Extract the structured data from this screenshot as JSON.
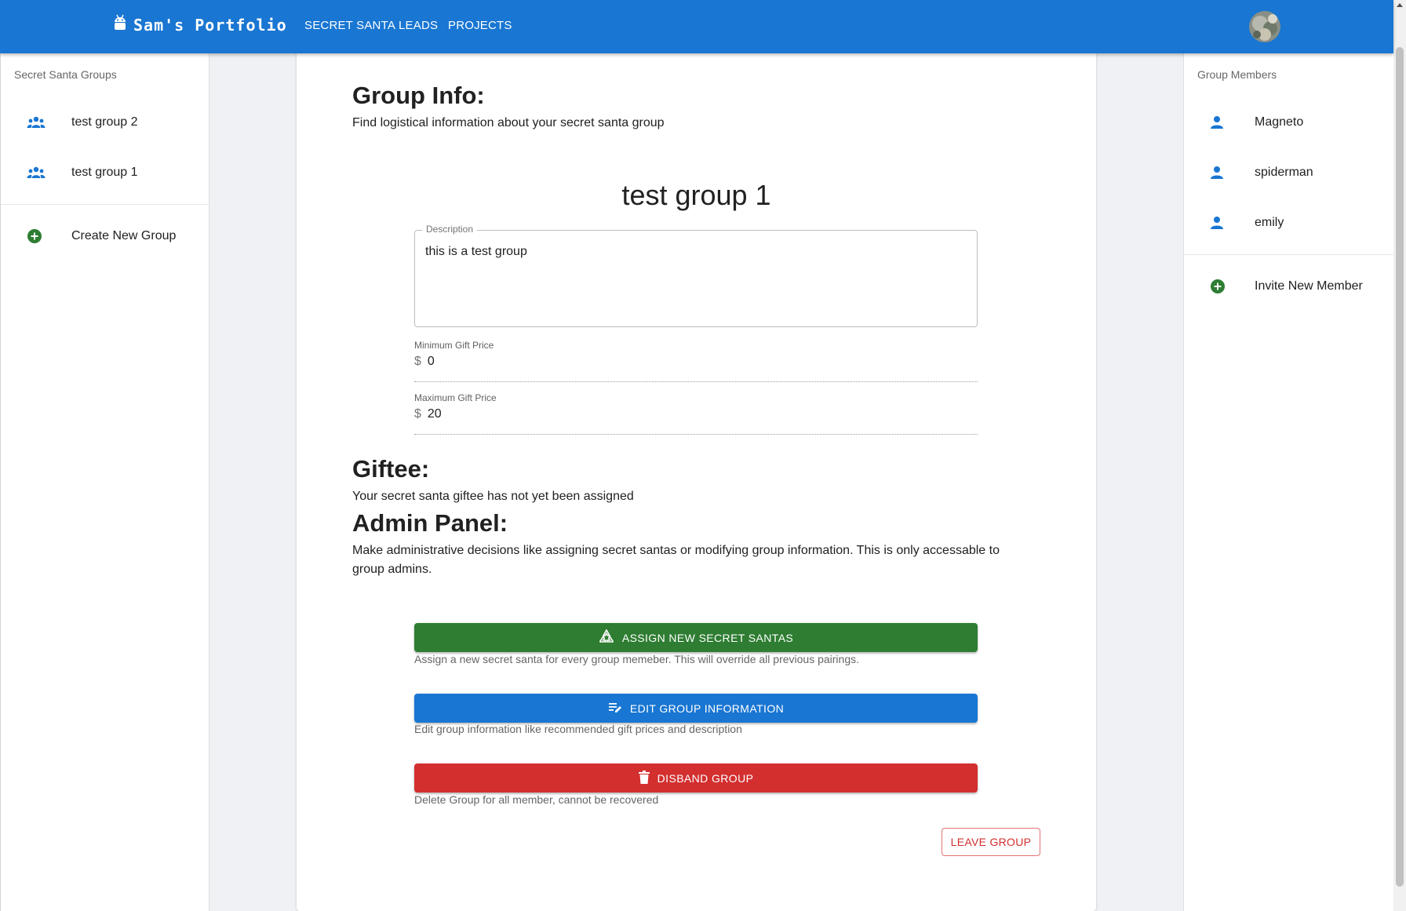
{
  "appbar": {
    "brand": "Sam's Portfolio",
    "nav": [
      "SECRET SANTA",
      "LEADS",
      "PROJECTS"
    ],
    "brand_icon": "android-icon",
    "avatar_icon": "user-avatar"
  },
  "left_drawer": {
    "header": "Secret Santa Groups",
    "groups": [
      {
        "label": "test group 2",
        "icon": "groups-icon"
      },
      {
        "label": "test group 1",
        "icon": "groups-icon"
      }
    ],
    "create_label": "Create New Group",
    "create_icon": "add-circle-icon"
  },
  "right_drawer": {
    "header": "Group Members",
    "members": [
      {
        "label": "Magneto",
        "icon": "person-icon"
      },
      {
        "label": "spiderman",
        "icon": "person-icon"
      },
      {
        "label": "emily",
        "icon": "person-icon"
      }
    ],
    "invite_label": "Invite New Member",
    "invite_icon": "add-circle-icon"
  },
  "main": {
    "group_info_title": "Group Info:",
    "group_info_desc": "Find logistical information about your secret santa group",
    "group_name": "test group 1",
    "description_label": "Description",
    "description_value": "this is a test group",
    "min_price_label": "Minimum Gift Price",
    "min_price_value": "0",
    "max_price_label": "Maximum Gift Price",
    "max_price_value": "20",
    "currency": "$",
    "giftee_title": "Giftee:",
    "giftee_desc": "Your secret santa giftee has not yet been assigned",
    "admin_title": "Admin Panel:",
    "admin_desc": "Make administrative decisions like assigning secret santas or modifying group information. This is only accessable to group admins.",
    "assign_button": "ASSIGN NEW SECRET SANTAS",
    "assign_helper": "Assign a new secret santa for every group memeber. This will override all previous pairings.",
    "edit_button": "EDIT GROUP INFORMATION",
    "edit_helper": "Edit group information like recommended gift prices and description",
    "disband_button": "DISBAND GROUP",
    "disband_helper": "Delete Group for all member, cannot be recovered",
    "leave_button": "LEAVE GROUP"
  },
  "colors": {
    "primary": "#1976d2",
    "success": "#2e7d32",
    "error": "#d32f2f"
  }
}
